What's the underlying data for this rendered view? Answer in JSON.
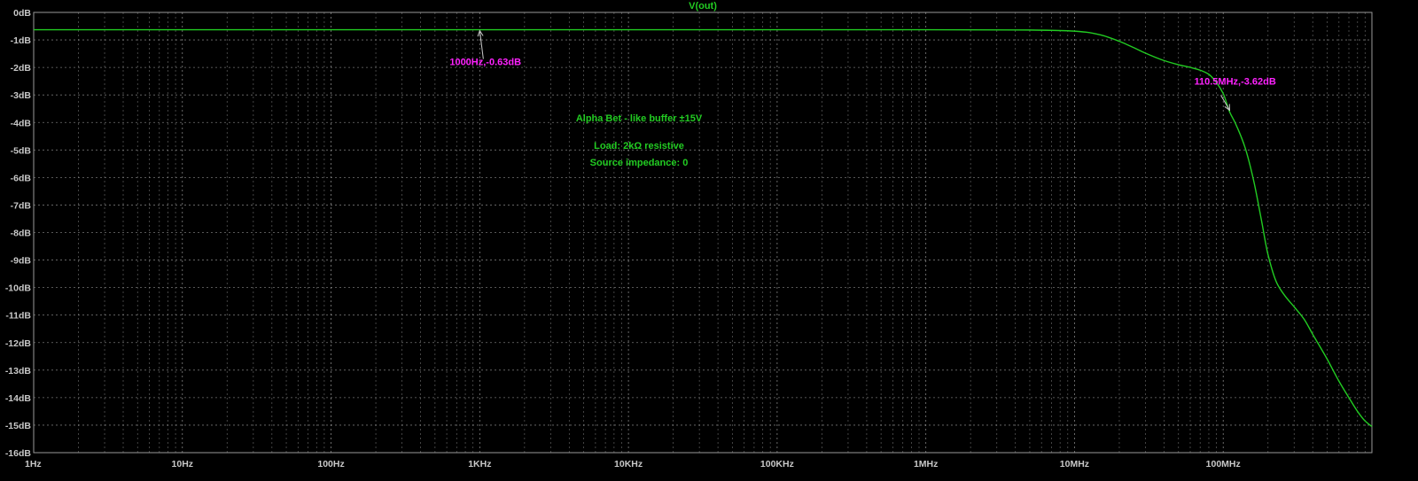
{
  "colors": {
    "background": "#000000",
    "frame": "#9a9a9a",
    "grid": "#9a9a9a",
    "axis_text": "#c8c8c8",
    "trace": "#22cc22",
    "annotation": "#22cc22",
    "cursor_label": "#ff22ff",
    "cursor_arrow": "#c8c8c8"
  },
  "chart_data": {
    "type": "line",
    "title": "V(out)",
    "x_scale": "log",
    "y_unit": "dB",
    "xlim_hz": [
      1,
      1000000000
    ],
    "ylim_db": [
      -16,
      0
    ],
    "grid": true,
    "x_tick_labels": [
      "1Hz",
      "10Hz",
      "100Hz",
      "1KHz",
      "10KHz",
      "100KHz",
      "1MHz",
      "10MHz",
      "100MHz"
    ],
    "x_ticks_hz": [
      1,
      10,
      100,
      1000,
      10000,
      100000,
      1000000,
      10000000,
      100000000
    ],
    "y_tick_labels": [
      "0dB",
      "-1dB",
      "-2dB",
      "-3dB",
      "-4dB",
      "-5dB",
      "-6dB",
      "-7dB",
      "-8dB",
      "-9dB",
      "-10dB",
      "-11dB",
      "-12dB",
      "-13dB",
      "-14dB",
      "-15dB",
      "-16dB"
    ],
    "y_ticks_db": [
      0,
      -1,
      -2,
      -3,
      -4,
      -5,
      -6,
      -7,
      -8,
      -9,
      -10,
      -11,
      -12,
      -13,
      -14,
      -15,
      -16
    ],
    "series": [
      {
        "name": "V(out)",
        "x_hz": [
          1,
          1000,
          1000000,
          5000000,
          8000000,
          10000000,
          12000000,
          15000000,
          20000000,
          25000000,
          30000000,
          40000000,
          50000000,
          60000000,
          70000000,
          80000000,
          90000000,
          100000000,
          110500000,
          120000000,
          140000000,
          160000000,
          180000000,
          200000000,
          230000000,
          260000000,
          300000000,
          350000000,
          400000000,
          500000000,
          600000000,
          700000000,
          800000000,
          900000000,
          1000000000
        ],
        "y_db": [
          -0.63,
          -0.63,
          -0.63,
          -0.64,
          -0.66,
          -0.68,
          -0.72,
          -0.82,
          -1.05,
          -1.28,
          -1.48,
          -1.75,
          -1.9,
          -2.0,
          -2.1,
          -2.25,
          -2.55,
          -2.95,
          -3.62,
          -4.0,
          -4.9,
          -6.1,
          -7.5,
          -8.8,
          -9.85,
          -10.3,
          -10.7,
          -11.15,
          -11.7,
          -12.6,
          -13.4,
          -14.0,
          -14.5,
          -14.85,
          -15.05
        ]
      }
    ],
    "cursors": [
      {
        "label": "1000Hz,-0.63dB",
        "x_hz": 1000,
        "y_db": -0.63
      },
      {
        "label": "110.5MHz,-3.62dB",
        "x_hz": 110500000,
        "y_db": -3.62
      }
    ],
    "annotations": [
      {
        "text": "Alpha Bet - like buffer ±15V"
      },
      {
        "text": "Load: 2kΩ resistive"
      },
      {
        "text": "Source impedance: 0"
      }
    ]
  }
}
